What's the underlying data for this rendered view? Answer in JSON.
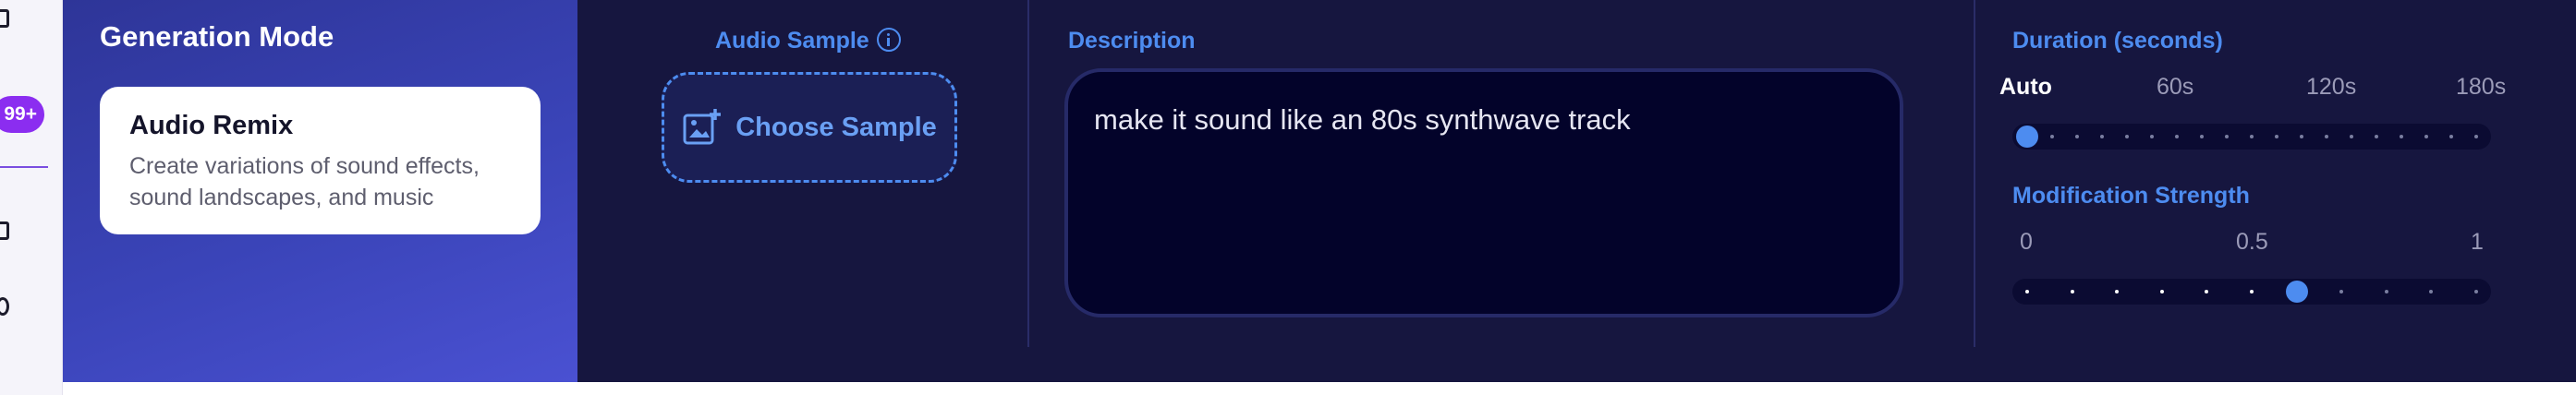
{
  "sidebar": {
    "badge": "99+"
  },
  "generation_mode": {
    "title": "Generation Mode",
    "selected_card": {
      "title": "Audio Remix",
      "description": "Create variations of sound effects, sound landscapes, and music"
    }
  },
  "audio_sample": {
    "label": "Audio Sample",
    "button_label": "Choose Sample"
  },
  "description": {
    "label": "Description",
    "value": "make it sound like an 80s synthwave track"
  },
  "duration": {
    "label": "Duration (seconds)",
    "ticks": [
      "Auto",
      "60s",
      "120s",
      "180s"
    ],
    "selected": "Auto",
    "value_fraction": 0
  },
  "modification_strength": {
    "label": "Modification Strength",
    "ticks": [
      "0",
      "0.5",
      "1"
    ],
    "value": 0.6
  },
  "colors": {
    "accent": "#4d8cf0",
    "band": "#16163f",
    "panel": "#3a44b8",
    "badge": "#8b2df0"
  }
}
